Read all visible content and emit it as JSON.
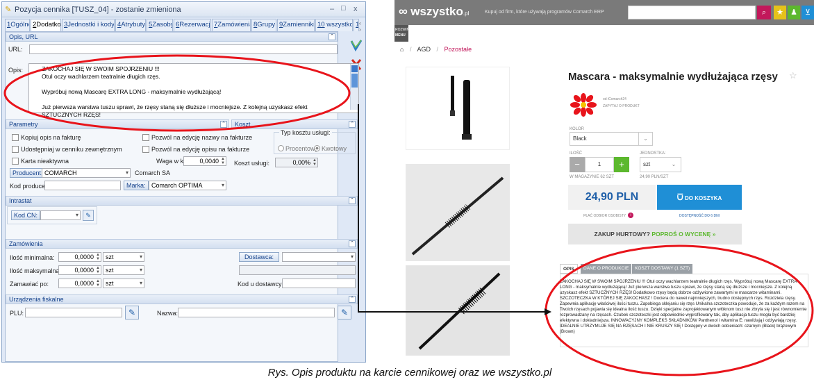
{
  "left_window": {
    "title": "Pozycja cennika [TUSZ_04] - zostanie zmieniona",
    "window_buttons": [
      "–",
      "□",
      "x"
    ],
    "tabs": [
      {
        "key": "1",
        "label": "Ogólne"
      },
      {
        "key": "2",
        "label": "Dodatkowe"
      },
      {
        "key": "3",
        "label": "Jednostki i kody"
      },
      {
        "key": "4",
        "label": "Atrybuty"
      },
      {
        "key": "5",
        "label": "Zasoby"
      },
      {
        "key": "6",
        "label": "Rezerwacje"
      },
      {
        "key": "7",
        "label": "Zamówienia"
      },
      {
        "key": "8",
        "label": "Grupy"
      },
      {
        "key": "9",
        "label": "Zamienniki"
      },
      {
        "key": "10",
        "label": "wszystko.pl"
      },
      {
        "key": "11",
        "label": ""
      }
    ],
    "sections": {
      "opis_url": "Opis, URL",
      "parametry": "Parametry",
      "koszt": "Koszt",
      "intrastat": "Intrastat",
      "zamowienia": "Zamówienia",
      "urzadzenia": "Urządzenia fiskalne"
    },
    "url_label": "URL:",
    "url_value": "",
    "opis_label": "Opis:",
    "opis_lines": [
      "ZAKOCHAJ SIĘ W SWOIM SPOJRZENIU !!!",
      "Otul oczy wachlarzem teatralnie długich rzęs.",
      "",
      "Wypróbuj nową Mascarę EXTRA LONG - maksymalnie wydłużającą!",
      "",
      "Już pierwsza warstwa tuszu sprawi, że rzęsy staną się dłuższe i mocniejsze. Z kolejną uzyskasz efekt SZTUCZNYCH RZĘS!"
    ],
    "checkboxes": {
      "kopiuj": "Kopiuj opis na fakturę",
      "udostepniaj": "Udostępniaj w cenniku zewnętrznym",
      "karta": "Karta nieaktywna",
      "pozwol_nazwa": "Pozwól na edycję nazwy na fakturze",
      "pozwol_opis": "Pozwól na edycję opisu na fakturze"
    },
    "waga_label": "Waga w kg:",
    "waga_value": "0,0040",
    "producent_btn": "Producent:",
    "producent_value": "COMARCH",
    "producent_name": "Comarch SA",
    "kod_producenta_label": "Kod producenta",
    "kod_producenta_value": "",
    "marka_btn": "Marka:",
    "marka_value": "Comarch OPTIMA",
    "typ_kosztu_label": "Typ kosztu usługi:",
    "procentowy": "Procentowy",
    "kwotowy": "Kwotowy",
    "koszt_uslugi_label": "Koszt usługi:",
    "koszt_uslugi_value": "0,00%",
    "kod_cn_btn": "Kod CN:",
    "ilosc_min_label": "Ilość minimalna:",
    "ilosc_max_label": "Ilość maksymalna:",
    "zamawiac_po_label": "Zamawiać po:",
    "qty_value": "0,0000",
    "unit": "szt",
    "dostawca_btn": "Dostawca:",
    "kod_u_dostawcy_label": "Kod u dostawcy:",
    "plu_label": "PLU:",
    "nazwa_label": "Nazwa:"
  },
  "web": {
    "logo": "wszystko",
    "logo_suffix": ".pl",
    "tagline": "Kupuj od firm, które używają programów Comarch ERP",
    "menu_label_1": "ROZWIŃ",
    "menu_label_2": "MENU",
    "breadcrumb": [
      "AGD",
      "Pozostałe"
    ],
    "product_title": "Mascara - maksymalnie wydłużająca rzęsy",
    "seller": "od iComarch24",
    "ask_link": "ZAPYTAJ O PRODUKT",
    "kolor_label": "KOLOR",
    "kolor_value": "Black",
    "ilosc_label": "ILOŚĆ",
    "qty": "1",
    "jednostka_label": "JEDNOSTKA:",
    "jednostka_value": "szt",
    "stock": "W MAGAZYNIE 62 SZT",
    "unit_price": "24,90 PLN/SZT",
    "price": "24,90 PLN",
    "cart_btn": "DO KOSZYKA",
    "free_shipping": "PŁAĆ ODBIOR OSOBISTY",
    "availability": "DOSTĘPNOŚĆ DO 6 DNI",
    "wholesale": "ZAKUP HURTOWY?",
    "ask_quote": "POPROŚ O WYCENĘ »",
    "tabs": [
      "OPIS",
      "DANE O PRODUKCIE",
      "KOSZT DOSTAWY (1 SZT)"
    ],
    "description": "ZAKOCHAJ SIĘ W SWOIM SPOJRZENIU !!! Otul oczy wachlarzem teatralnie długich rzęs. Wypróbuj nową Mascarę EXTRA LONG - maksymalnie wydłużającą! Już pierwsza warstwa tuszu sprawi, że rzęsy staną się dłuższe i mocniejsze. Z kolejną uzyskasz efekt SZTUCZNYCH RZĘS! Dodatkowo rzęsy będą dobrze odżywione zawartymi w mascarze witaminami. SZCZOTECZKA W KTÓREJ SIĘ ZAKOCHASZ ! Dociera do nawet najmniejszych, trudno dostępnych rzęs. Rozdziela rzęsy. Zapewnia aplikację właściwej ilości tuszu. Zapobiega sklejaniu się rzęs Unikalna szczoteczka powoduje, że za każdym razem na Twoich rzęsach pojawia się idealna ilość tuszu. Dzięki specjalne zaprojektowanym włóknom tusz nie zbryla się i jest równomiernie rozprowadzany na rzęsach. Czubek szczoteczki jest odpowiednio wyprofilowany tak, aby aplikacja tuszu mogła być bardziej efektywna i dokładniejsza. INNOWACYJNY KOMPLEKS SKŁADNIKÓW Panthenol i witamina E: nawilżają i odżywiają rzęsy. IDEALNIE UTRZYMUJE SIĘ NA RZĘSACH I NIE KRUSZY SIĘ ! Dostępny w dwóch odcieniach: czarnym (Black) brązowym (Brown)"
  },
  "caption": "Rys. Opis produktu na karcie cennikowej oraz we wszystko.pl",
  "colors": {
    "annotation": "#e8141b",
    "brand_blue": "#1f8fd6",
    "green": "#5cb82e",
    "header_gray": "#7a7a7a"
  }
}
